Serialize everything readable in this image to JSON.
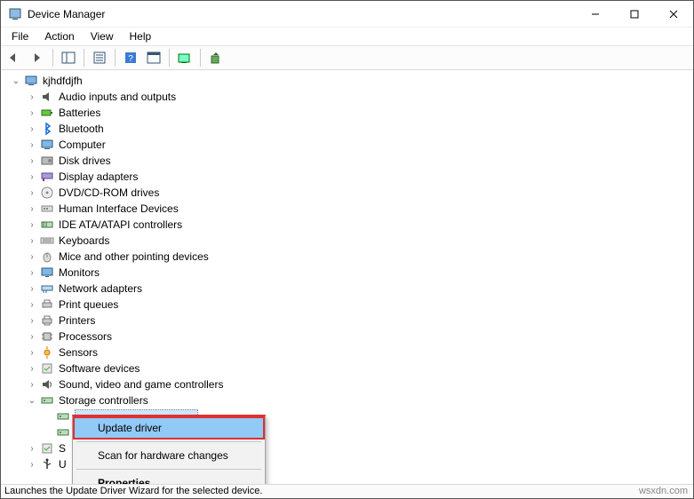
{
  "title": "Device Manager",
  "menus": {
    "file": "File",
    "action": "Action",
    "view": "View",
    "help": "Help"
  },
  "root": "kjhdfdjfh",
  "categories": [
    "Audio inputs and outputs",
    "Batteries",
    "Bluetooth",
    "Computer",
    "Disk drives",
    "Display adapters",
    "DVD/CD-ROM drives",
    "Human Interface Devices",
    "IDE ATA/ATAPI controllers",
    "Keyboards",
    "Mice and other pointing devices",
    "Monitors",
    "Network adapters",
    "Print queues",
    "Printers",
    "Processors",
    "Sensors",
    "Software devices",
    "Sound, video and game controllers",
    "Storage controllers"
  ],
  "tail": [
    "S",
    "U"
  ],
  "context_menu": {
    "update": "Update driver",
    "scan": "Scan for hardware changes",
    "props": "Properties"
  },
  "status": "Launches the Update Driver Wizard for the selected device.",
  "watermark": "wsxdn.com"
}
